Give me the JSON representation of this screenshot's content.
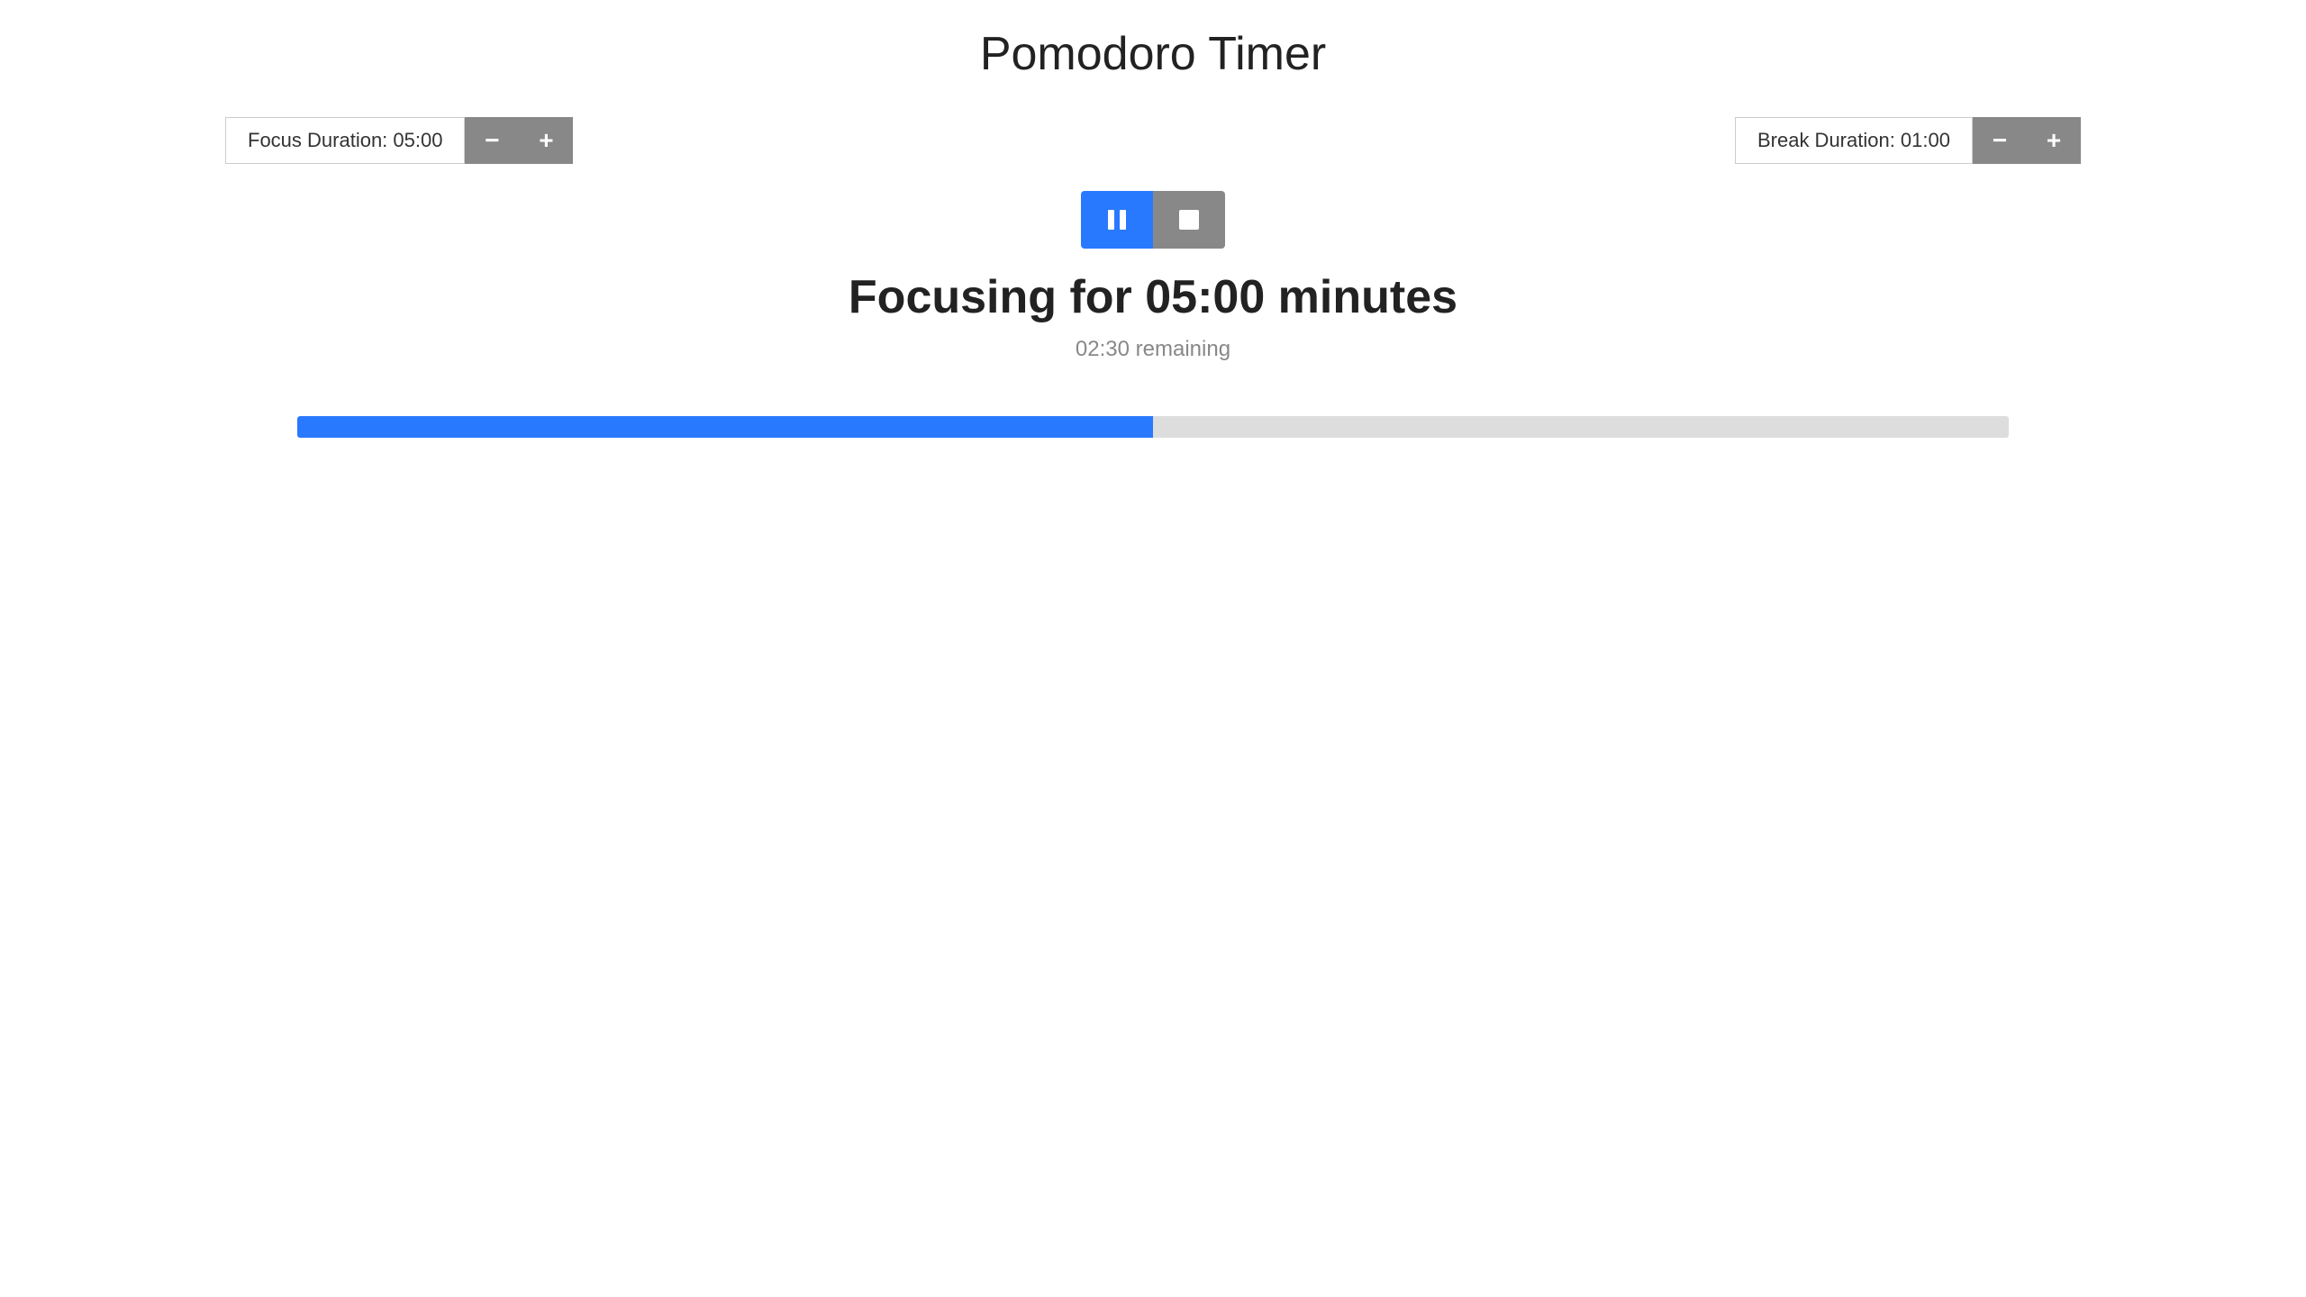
{
  "app": {
    "title": "Pomodoro Timer"
  },
  "focus_control": {
    "label": "Focus Duration: 05:00",
    "minus_label": "−",
    "plus_label": "+"
  },
  "break_control": {
    "label": "Break Duration: 01:00",
    "minus_label": "−",
    "plus_label": "+"
  },
  "timer": {
    "focusing_text": "Focusing for 05:00 minutes",
    "remaining_text": "02:30 remaining",
    "progress_percent": 50,
    "progress_width_pct": "50"
  }
}
